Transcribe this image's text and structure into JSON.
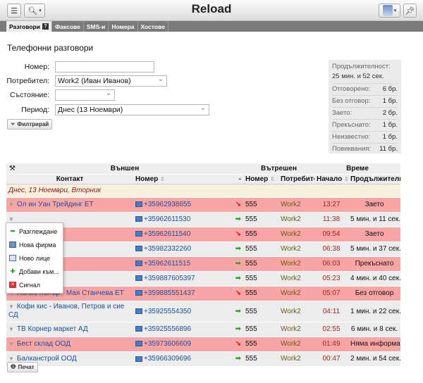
{
  "app": {
    "title": "Reload"
  },
  "tabs": [
    {
      "label": "Разговори"
    },
    {
      "label": "Факсове"
    },
    {
      "label": "SMS-и"
    },
    {
      "label": "Номера"
    },
    {
      "label": "Хостове"
    }
  ],
  "tab_help": "?",
  "page": {
    "heading": "Телефонни разговори"
  },
  "filters": {
    "number_label": "Номер:",
    "number_value": "",
    "user_label": "Потребител:",
    "user_value": "Work2 (Иван Иванов)",
    "state_label": "Състояние:",
    "state_value": "",
    "period_label": "Период:",
    "period_value": "Днес (13 Ноември)",
    "filter_button": "Филтрирай"
  },
  "stats": {
    "duration_label": "Продължителност:",
    "duration_value": "25 мин. и 52 сек.",
    "rows": [
      {
        "label": "Отговорено:",
        "value": "6 бр."
      },
      {
        "label": "Без отговор:",
        "value": "1 бр."
      },
      {
        "label": "Заето:",
        "value": "2 бр."
      },
      {
        "label": "Прекъснато:",
        "value": "1 бр."
      },
      {
        "label": "Неизвестно:",
        "value": "1 бр."
      },
      {
        "label": "Повиквания:",
        "value": "11 бр."
      }
    ]
  },
  "table": {
    "group_external": "Външен",
    "group_internal": "Вътрешен",
    "group_time": "Време",
    "col_contact": "Контакт",
    "col_number": "Номер",
    "col_int_number": "Номер",
    "col_user": "Потребител",
    "col_start": "Начало",
    "col_duration": "Продължителност",
    "dash": "-",
    "date_row": "Днес, 13 Ноември, Вторник",
    "rows": [
      {
        "contact": "Ол ин Уан Трейдинг ЕТ",
        "number": "+35962938655",
        "direction": "missed",
        "ext": "555",
        "user": "Work2",
        "start": "13:27",
        "duration": "Заето",
        "status": "red"
      },
      {
        "contact": "",
        "number": "+35962611530",
        "direction": "in",
        "ext": "555",
        "user": "Work2",
        "start": "11:38",
        "duration": "5 мин. и 11 сек.",
        "status": "grey"
      },
      {
        "contact": "Д",
        "number": "+35962611540",
        "direction": "missed",
        "ext": "555",
        "user": "Work2",
        "start": "09:54",
        "duration": "Заето",
        "status": "red"
      },
      {
        "contact": "Д",
        "number": "+35982332260",
        "direction": "in",
        "ext": "555",
        "user": "Work2",
        "start": "06:38",
        "duration": "5 мин. и 37 сек.",
        "status": "grey"
      },
      {
        "contact": "",
        "number": "+35962611515",
        "direction": "in",
        "ext": "555",
        "user": "Work2",
        "start": "06:03",
        "duration": "Прекъснато",
        "status": "red"
      },
      {
        "contact": "",
        "number": "+359887605397",
        "direction": "in",
        "ext": "555",
        "user": "Work2",
        "start": "05:23",
        "duration": "4 мин. и 40 сек.",
        "status": "grey"
      },
      {
        "contact": "Полис Къпър - Мая Станчева ЕТ",
        "number": "+359885551437",
        "direction": "missed",
        "ext": "555",
        "user": "Work2",
        "start": "05:07",
        "duration": "Без отговор",
        "status": "red"
      },
      {
        "contact": "Кофи кис - Иванов, Петров и сие СД",
        "number": "+35925554350",
        "direction": "in",
        "ext": "555",
        "user": "Work2",
        "start": "04:11",
        "duration": "1 мин. и 22 сек.",
        "status": "grey"
      },
      {
        "contact": "ТВ Корнер маркет АД",
        "number": "+35925556896",
        "direction": "in",
        "ext": "555",
        "user": "Work2",
        "start": "02:55",
        "duration": "6 мин. и 8 сек.",
        "status": "grey"
      },
      {
        "contact": "Бест склад ООД",
        "number": "+35973606609",
        "direction": "missed",
        "ext": "555",
        "user": "Work2",
        "start": "01:49",
        "duration": "Няма информация",
        "status": "red"
      },
      {
        "contact": "Балканстрой ООД",
        "number": "+35966309696",
        "direction": "in",
        "ext": "555",
        "user": "Work2",
        "start": "00:47",
        "duration": "2 мин. и 54 сек.",
        "status": "grey"
      }
    ]
  },
  "context_menu": [
    {
      "label": "Разглеждане",
      "icon": "arrow-right-icon"
    },
    {
      "label": "Нова фирма",
      "icon": "company-icon"
    },
    {
      "label": "Ново лице",
      "icon": "person-card-icon"
    },
    {
      "label": "Добави към...",
      "icon": "add-icon"
    },
    {
      "label": "Сигнал",
      "icon": "alert-icon"
    }
  ],
  "print_button": "Печат",
  "colors": {
    "missed_row": "#f9a5a5",
    "answered_row": "#ececec",
    "date_row": "#f5f0dc",
    "link": "#1b4f9a"
  }
}
